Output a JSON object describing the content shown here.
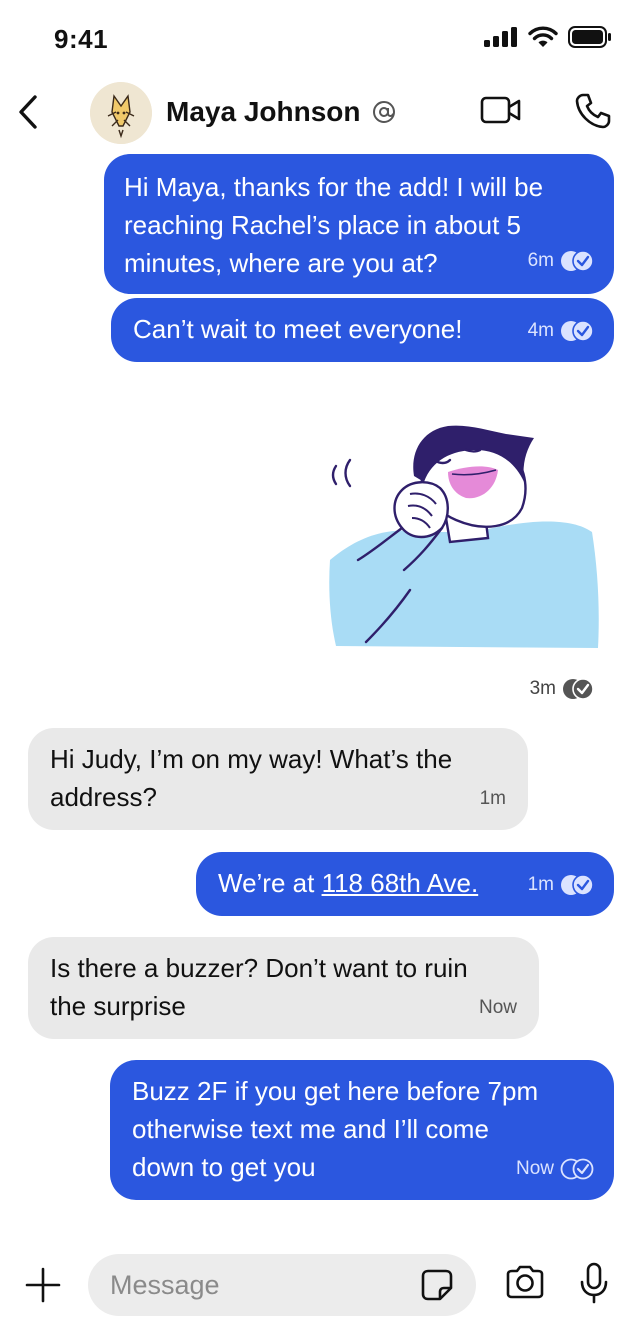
{
  "status_bar": {
    "time": "9:41"
  },
  "header": {
    "contact_name": "Maya Johnson"
  },
  "messages": [
    {
      "direction": "out",
      "lines": [
        "Hi Maya, thanks for the add! I will be",
        "reaching Rachel’s place in about 5",
        "minutes, where are you at?"
      ],
      "time": "6m",
      "status": "read"
    },
    {
      "direction": "out",
      "lines": [
        "Can’t wait to meet everyone!"
      ],
      "time": "4m",
      "status": "read"
    },
    {
      "direction": "out",
      "type": "sticker",
      "time": "3m",
      "status": "read"
    },
    {
      "direction": "in",
      "lines": [
        "Hi Judy, I’m on my way! What’s the",
        "address?"
      ],
      "time": "1m"
    },
    {
      "direction": "out",
      "prefix": "We’re at ",
      "link": "118 68th Ave.",
      "time": "1m",
      "status": "read"
    },
    {
      "direction": "in",
      "lines": [
        "Is there a buzzer? Don’t want to ruin",
        "the surprise"
      ],
      "time": "Now"
    },
    {
      "direction": "out",
      "lines": [
        "Buzz 2F if you get here before 7pm",
        "otherwise text me and I’ll come",
        "down to get you"
      ],
      "time": "Now",
      "status": "delivered"
    }
  ],
  "composer": {
    "placeholder": "Message"
  },
  "colors": {
    "outgoing": "#2b57df",
    "incoming": "#e9e9e9",
    "sticker_shirt": "#a9dcf5",
    "sticker_hair": "#2f1f6b",
    "sticker_lips": "#e58ad8"
  }
}
